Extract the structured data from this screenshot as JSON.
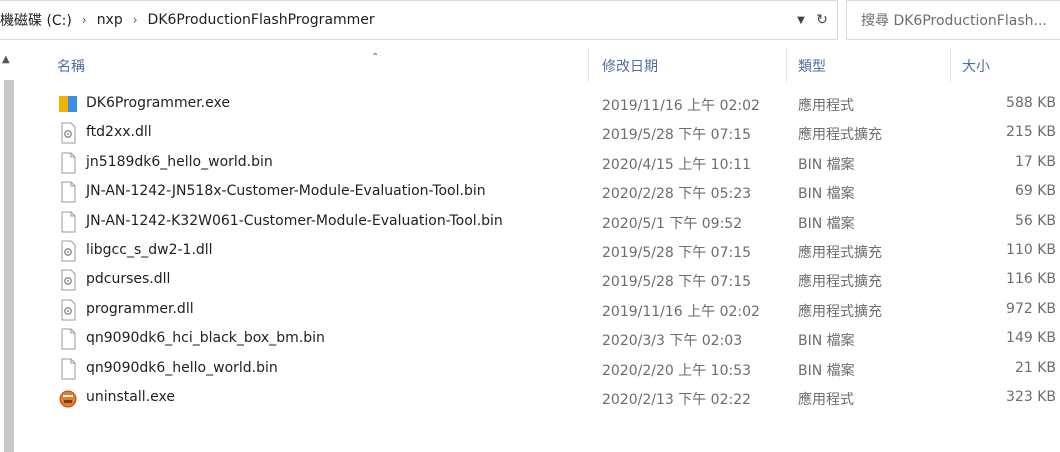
{
  "address": {
    "drive": "本機磁碟 (C:)",
    "folder1": "nxp",
    "folder2": "DK6ProductionFlashProgrammer",
    "separator": "›"
  },
  "search": {
    "placeholder": "搜尋 DK6ProductionFlash..."
  },
  "columns": {
    "name": "名稱",
    "date": "修改日期",
    "type": "類型",
    "size": "大小"
  },
  "files": [
    {
      "name": "DK6Programmer.exe",
      "date": "2019/11/16 上午 02:02",
      "type": "應用程式",
      "size": "588 KB",
      "icon": "app-exe-icon"
    },
    {
      "name": "ftd2xx.dll",
      "date": "2019/5/28 下午 07:15",
      "type": "應用程式擴充",
      "size": "215 KB",
      "icon": "dll-file-icon"
    },
    {
      "name": "jn5189dk6_hello_world.bin",
      "date": "2020/4/15 上午 10:11",
      "type": "BIN 檔案",
      "size": "17 KB",
      "icon": "generic-file-icon"
    },
    {
      "name": "JN-AN-1242-JN518x-Customer-Module-Evaluation-Tool.bin",
      "date": "2020/2/28 下午 05:23",
      "type": "BIN 檔案",
      "size": "69 KB",
      "icon": "generic-file-icon"
    },
    {
      "name": "JN-AN-1242-K32W061-Customer-Module-Evaluation-Tool.bin",
      "date": "2020/5/1 下午 09:52",
      "type": "BIN 檔案",
      "size": "56 KB",
      "icon": "generic-file-icon"
    },
    {
      "name": "libgcc_s_dw2-1.dll",
      "date": "2019/5/28 下午 07:15",
      "type": "應用程式擴充",
      "size": "110 KB",
      "icon": "dll-file-icon"
    },
    {
      "name": "pdcurses.dll",
      "date": "2019/5/28 下午 07:15",
      "type": "應用程式擴充",
      "size": "116 KB",
      "icon": "dll-file-icon"
    },
    {
      "name": "programmer.dll",
      "date": "2019/11/16 上午 02:02",
      "type": "應用程式擴充",
      "size": "972 KB",
      "icon": "dll-file-icon"
    },
    {
      "name": "qn9090dk6_hci_black_box_bm.bin",
      "date": "2020/3/3 下午 02:03",
      "type": "BIN 檔案",
      "size": "149 KB",
      "icon": "generic-file-icon"
    },
    {
      "name": "qn9090dk6_hello_world.bin",
      "date": "2020/2/20 上午 10:53",
      "type": "BIN 檔案",
      "size": "21 KB",
      "icon": "generic-file-icon"
    },
    {
      "name": "uninstall.exe",
      "date": "2020/2/13 下午 02:22",
      "type": "應用程式",
      "size": "323 KB",
      "icon": "uninstall-icon"
    }
  ],
  "colors": {
    "header_text": "#4d6ca4",
    "meta_text": "#6d6d6d"
  }
}
